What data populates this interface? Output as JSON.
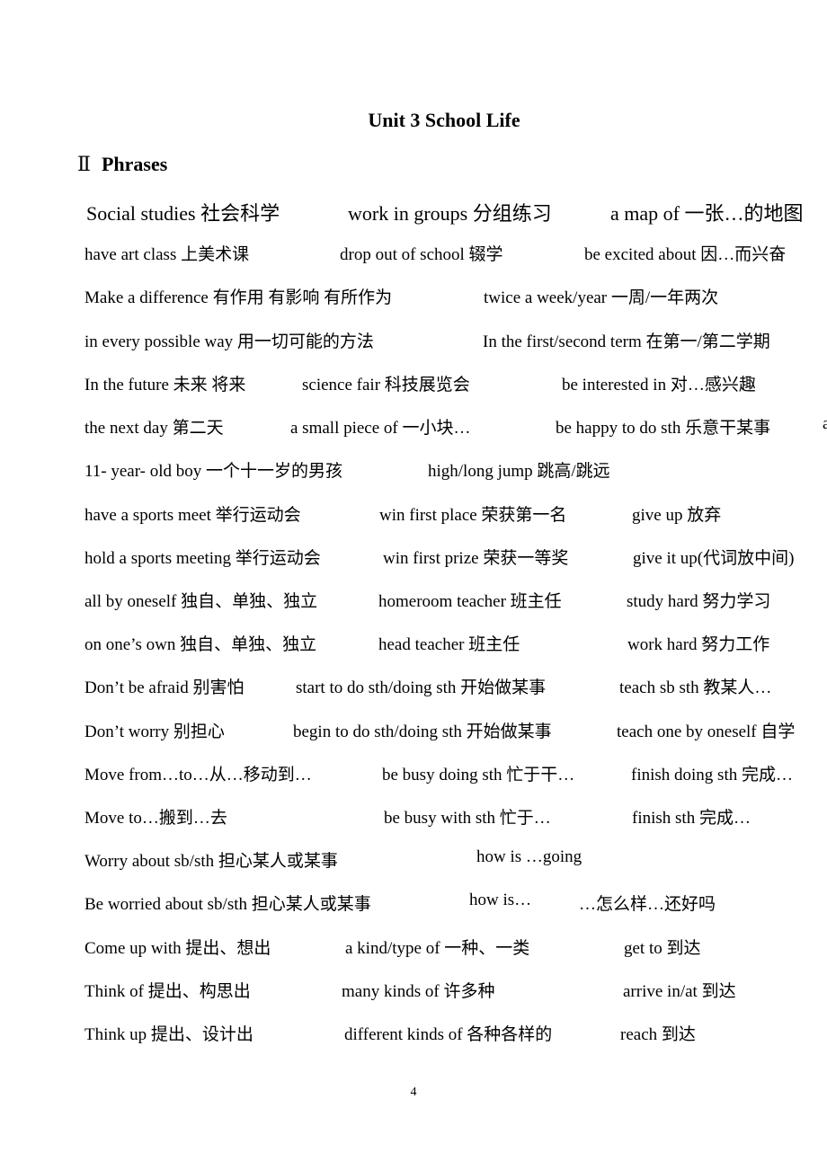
{
  "document": {
    "title": "Unit 3 School Life",
    "section": {
      "numeral": "Ⅱ",
      "label": "Phrases"
    },
    "rows": [
      [
        "Social studies 社会科学",
        "work in groups 分组练习",
        "a map of 一张…的地图"
      ],
      [
        "have art class 上美术课",
        "drop out of school 辍学",
        "be excited about 因…而兴奋"
      ],
      [
        "Make a difference 有作用  有影响  有所作为",
        "twice a week/year 一周/一年两次",
        ""
      ],
      [
        "in every possible way 用一切可能的方法",
        "In the first/second term 在第一/第二学期",
        ""
      ],
      [
        "In the future 未来  将来",
        "science fair 科技展览会",
        "be interested in  对…感兴趣"
      ],
      [
        "the next day 第二天",
        "a small piece of 一小块…",
        "be happy to do sth  乐意干某事",
        "a"
      ],
      [
        "11- year- old boy 一个十一岁的男孩",
        "high/long jump 跳高/跳远",
        ""
      ],
      [
        "have a sports meet 举行运动会",
        "win first place 荣获第一名",
        "give up 放弃"
      ],
      [
        "hold a sports meeting 举行运动会",
        "win first prize 荣获一等奖",
        "give it up(代词放中间)"
      ],
      [
        "all by oneself 独自、单独、独立",
        "homeroom teacher 班主任",
        "study hard 努力学习"
      ],
      [
        "on one’s own 独自、单独、独立",
        "head teacher 班主任",
        "work hard 努力工作"
      ],
      [
        "Don’t be afraid 别害怕",
        "start to do sth/doing sth 开始做某事",
        "teach sb sth 教某人…"
      ],
      [
        "Don’t worry 别担心",
        "begin to do sth/doing sth 开始做某事",
        "teach one by oneself 自学"
      ],
      [
        "Move from…to…从…移动到…",
        "be busy doing sth 忙于干…",
        "finish doing sth 完成…"
      ],
      [
        "Move to…搬到…去",
        "be busy with sth 忙于…",
        "finish sth 完成…"
      ],
      [
        "Worry about sb/sth  担心某人或某事",
        "how is  …going",
        ""
      ],
      [
        "Be worried about sb/sth 担心某人或某事",
        "how is…",
        "…怎么样…还好吗"
      ],
      [
        "Come up with 提出、想出",
        "a kind/type of 一种、一类",
        "get to 到达"
      ],
      [
        "Think of 提出、构思出",
        "many kinds of 许多种",
        "arrive in/at 到达"
      ],
      [
        "Think up 提出、设计出",
        "different kinds of 各种各样的",
        "reach 到达"
      ]
    ],
    "page_number": "4"
  }
}
